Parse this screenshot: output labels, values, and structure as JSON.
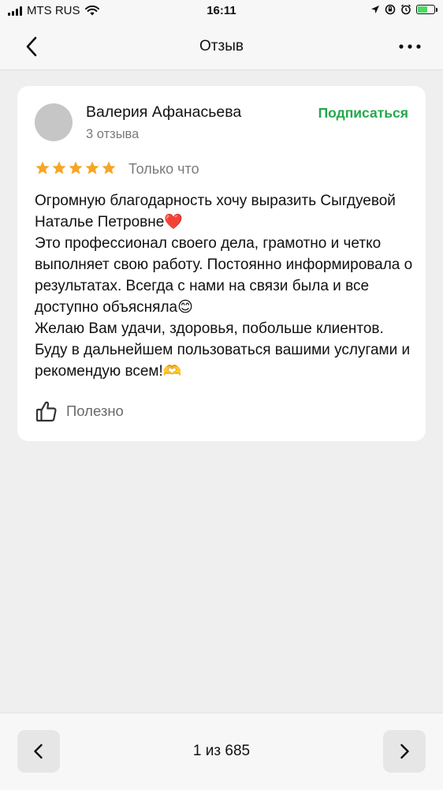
{
  "status_bar": {
    "carrier": "MTS RUS",
    "time": "16:11"
  },
  "nav": {
    "title": "Отзыв",
    "back_icon": "chevron-left-icon",
    "more_icon": "more-horizontal-icon"
  },
  "review": {
    "author": "Валерия Афанасьева",
    "reviews_count": "3 отзыва",
    "subscribe_label": "Подписаться",
    "rating": 5,
    "rating_max": 5,
    "date": "Только что",
    "text_lines": [
      "Огромную благодарность хочу выразить Сыгдуевой Наталье Петровне❤️",
      "Это профессионал своего дела, грамотно и четко выполняет свою работу. Постоянно информировала о результатах. Всегда с нами на связи была и все доступно объясняла😊",
      "Желаю Вам удачи, здоровья, побольше клиентов. Буду в дальнейшем пользоваться вашими услугами и рекомендую всем!🫶"
    ],
    "helpful_label": "Полезно"
  },
  "pager": {
    "label": "1 из 685"
  },
  "colors": {
    "accent_green": "#22a84a",
    "star": "#f5a623",
    "background": "#efeff0"
  }
}
